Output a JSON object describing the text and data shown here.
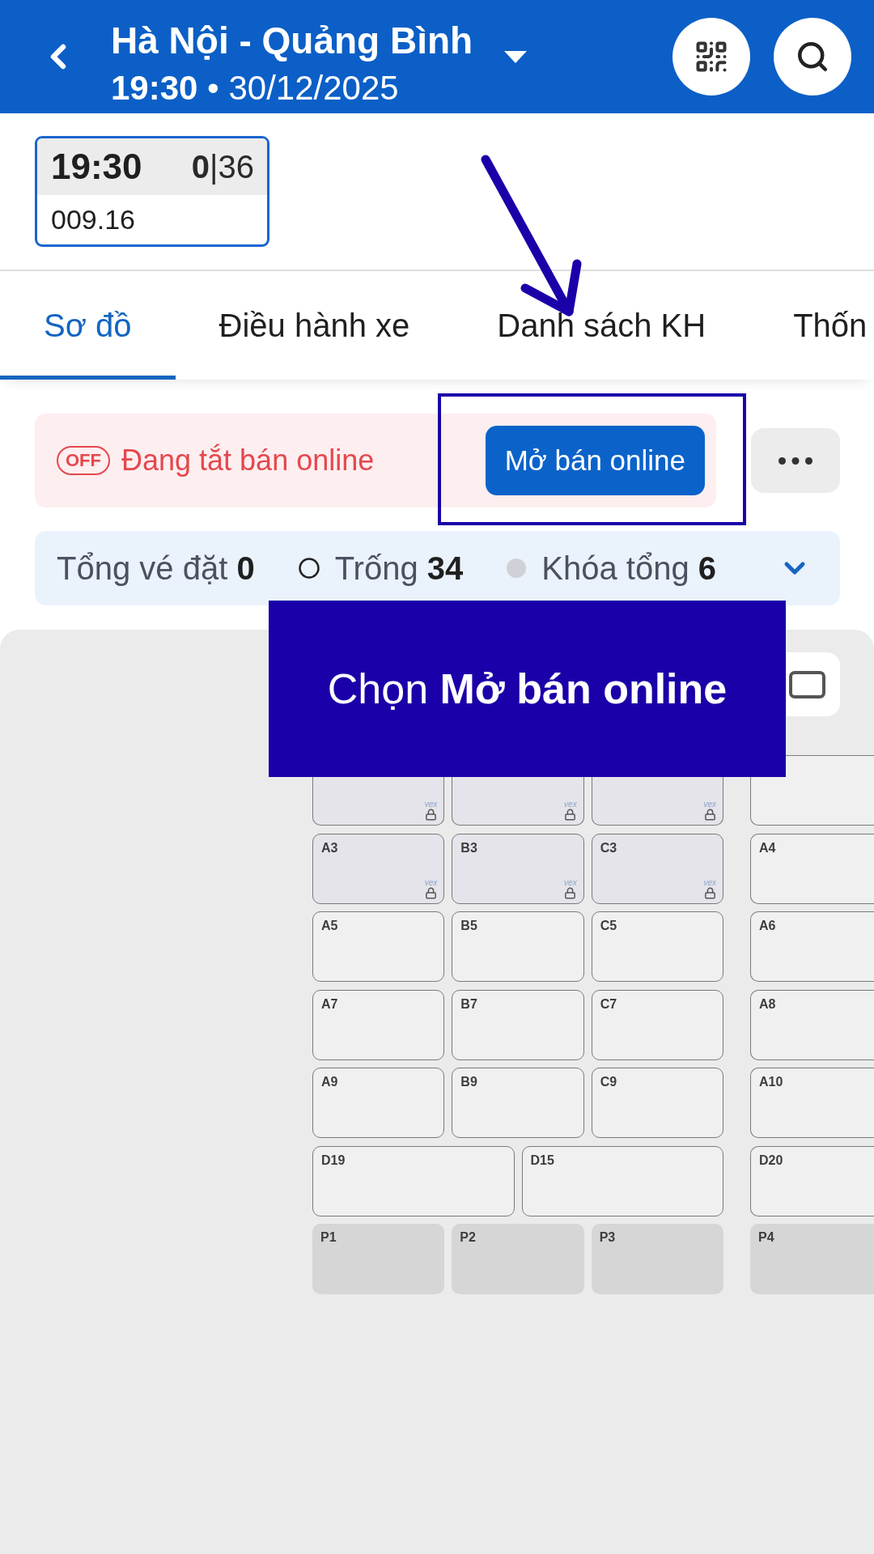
{
  "header": {
    "title": "Hà Nội - Quảng Bình",
    "subtitle": "**19:30** • 30/12/2025"
  },
  "trips": [
    {
      "time": "19:30",
      "seats": "**0**|36",
      "code": "009.16",
      "selected": true
    }
  ],
  "tabs": [
    {
      "label": "Sơ đồ",
      "selected": true
    },
    {
      "label": "Điều hành xe",
      "selected": false
    },
    {
      "label": "Danh sách KH",
      "selected": false
    },
    {
      "label": "Thốn",
      "selected": false
    }
  ],
  "online_sale": {
    "on": false,
    "badge": "OFF",
    "status": "Đang tắt bán online",
    "button": "Mở bán online"
  },
  "summary": {
    "expanded": false,
    "items": [
      {
        "kind": "plain",
        "text": "Tổng vé đặt **0**"
      },
      {
        "kind": "ring",
        "text": "Trống **34**"
      },
      {
        "kind": "dot",
        "text": "Khóa tổng **6**"
      }
    ]
  },
  "seat_map": {
    "rows": [
      {
        "left": [
          {
            "kind": "outline",
            "locked": true,
            "tag": "vex"
          },
          {
            "kind": "outline",
            "locked": true,
            "tag": "vex"
          },
          {
            "kind": "outline",
            "locked": true,
            "tag": "vex"
          }
        ],
        "right": [
          {
            "kind": "outline",
            "locked": false
          }
        ]
      },
      {
        "left": [
          {
            "label": "A3",
            "kind": "outline",
            "locked": true,
            "tag": "vex"
          },
          {
            "label": "B3",
            "kind": "outline",
            "locked": true,
            "tag": "vex"
          },
          {
            "label": "C3",
            "kind": "outline",
            "locked": true,
            "tag": "vex"
          }
        ],
        "right": [
          {
            "label": "A4",
            "kind": "outline",
            "locked": false
          }
        ]
      },
      {
        "left": [
          {
            "label": "A5",
            "kind": "outline",
            "locked": false
          },
          {
            "label": "B5",
            "kind": "outline",
            "locked": false
          },
          {
            "label": "C5",
            "kind": "outline",
            "locked": false
          }
        ],
        "right": [
          {
            "label": "A6",
            "kind": "outline",
            "locked": false
          }
        ]
      },
      {
        "left": [
          {
            "label": "A7",
            "kind": "outline",
            "locked": false
          },
          {
            "label": "B7",
            "kind": "outline",
            "locked": false
          },
          {
            "label": "C7",
            "kind": "outline",
            "locked": false
          }
        ],
        "right": [
          {
            "label": "A8",
            "kind": "outline",
            "locked": false
          }
        ]
      },
      {
        "left": [
          {
            "label": "A9",
            "kind": "outline",
            "locked": false
          },
          {
            "label": "B9",
            "kind": "outline",
            "locked": false
          },
          {
            "label": "C9",
            "kind": "outline",
            "locked": false
          }
        ],
        "right": [
          {
            "label": "A10",
            "kind": "outline",
            "locked": false
          }
        ]
      },
      {
        "left": [
          {
            "label": "D19",
            "kind": "outline",
            "locked": false
          },
          {
            "label": "D15",
            "kind": "outline",
            "locked": false
          }
        ],
        "right": [
          {
            "label": "D20",
            "kind": "outline",
            "locked": false
          }
        ]
      },
      {
        "left": [
          {
            "label": "P1",
            "kind": "solid",
            "locked": false
          },
          {
            "label": "P2",
            "kind": "solid",
            "locked": false
          },
          {
            "label": "P3",
            "kind": "solid",
            "locked": false
          }
        ],
        "right": [
          {
            "label": "P4",
            "kind": "solid",
            "locked": false
          }
        ]
      }
    ]
  },
  "annotation": {
    "callout": "Chọn **Mở bán online**"
  }
}
